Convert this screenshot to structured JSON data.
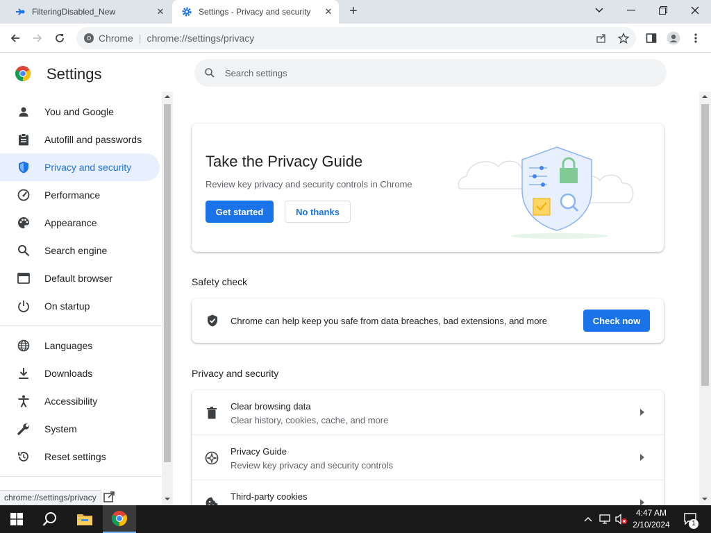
{
  "tabs": [
    {
      "title": "FilteringDisabled_New",
      "close": "✕"
    },
    {
      "title": "Settings - Privacy and security",
      "close": "✕"
    }
  ],
  "window": {
    "new_tab": "+",
    "minimize": "—",
    "maximize": "❐",
    "close": "✕",
    "tab_search": "⌄"
  },
  "omnibox": {
    "site_label": "Chrome",
    "url": "chrome://settings/privacy"
  },
  "header": {
    "title": "Settings",
    "search_placeholder": "Search settings"
  },
  "sidebar": {
    "items": [
      {
        "label": "You and Google",
        "icon": "person-icon"
      },
      {
        "label": "Autofill and passwords",
        "icon": "clipboard-icon"
      },
      {
        "label": "Privacy and security",
        "icon": "shield-icon",
        "active": true
      },
      {
        "label": "Performance",
        "icon": "speedometer-icon"
      },
      {
        "label": "Appearance",
        "icon": "palette-icon"
      },
      {
        "label": "Search engine",
        "icon": "search-icon"
      },
      {
        "label": "Default browser",
        "icon": "browser-icon"
      },
      {
        "label": "On startup",
        "icon": "power-icon"
      },
      {
        "label": "Languages",
        "icon": "globe-icon"
      },
      {
        "label": "Downloads",
        "icon": "download-icon"
      },
      {
        "label": "Accessibility",
        "icon": "accessibility-icon"
      },
      {
        "label": "System",
        "icon": "wrench-icon"
      },
      {
        "label": "Reset settings",
        "icon": "reset-icon"
      }
    ]
  },
  "privacy_guide_card": {
    "title": "Take the Privacy Guide",
    "description": "Review key privacy and security controls in Chrome",
    "primary_button": "Get started",
    "secondary_button": "No thanks"
  },
  "safety_check": {
    "section_title": "Safety check",
    "text": "Chrome can help keep you safe from data breaches, bad extensions, and more",
    "button": "Check now"
  },
  "privacy_section": {
    "section_title": "Privacy and security",
    "rows": [
      {
        "title": "Clear browsing data",
        "subtitle": "Clear history, cookies, cache, and more",
        "icon": "trash-icon"
      },
      {
        "title": "Privacy Guide",
        "subtitle": "Review key privacy and security controls",
        "icon": "compass-icon"
      },
      {
        "title": "Third-party cookies",
        "subtitle": "",
        "icon": "cookie-icon"
      }
    ]
  },
  "status_bubble": "chrome://settings/privacy",
  "taskbar": {
    "time": "4:47 AM",
    "date": "2/10/2024",
    "notification_count": "1"
  },
  "colors": {
    "accent": "#1a73e8",
    "active_nav_bg": "#e8f0fe",
    "taskbar": "#1a1a1a"
  }
}
